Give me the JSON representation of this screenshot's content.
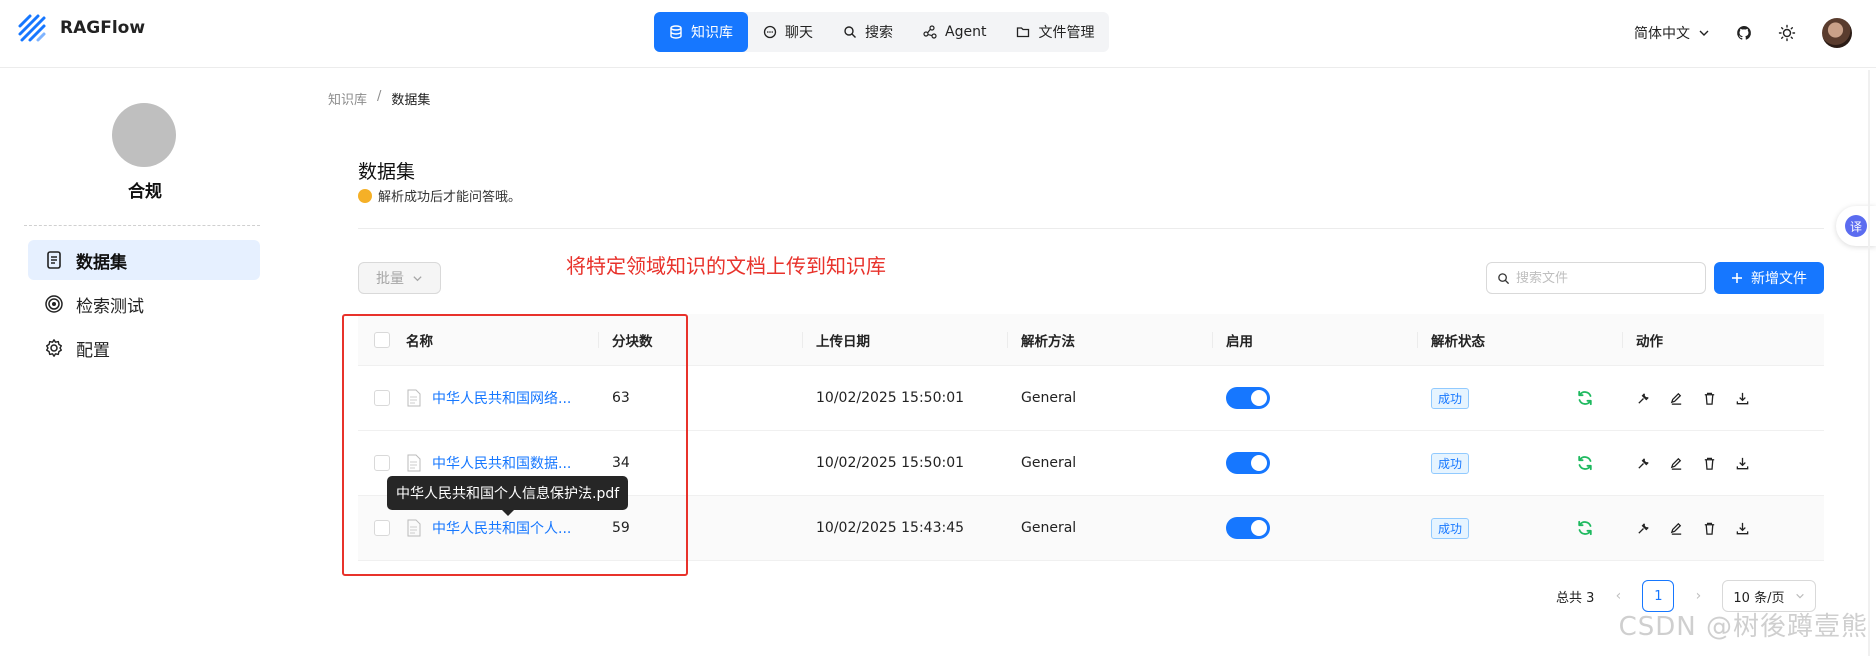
{
  "header": {
    "brand": "RAGFlow",
    "nav": [
      {
        "label": "知识库",
        "icon": "database-icon",
        "active": true
      },
      {
        "label": "聊天",
        "icon": "chat-icon",
        "active": false
      },
      {
        "label": "搜索",
        "icon": "search-icon",
        "active": false
      },
      {
        "label": "Agent",
        "icon": "agent-icon",
        "active": false
      },
      {
        "label": "文件管理",
        "icon": "folder-icon",
        "active": false
      }
    ],
    "language": "简体中文"
  },
  "sidebar": {
    "kb_name": "合规",
    "items": [
      {
        "label": "数据集",
        "icon": "document-icon",
        "active": true
      },
      {
        "label": "检索测试",
        "icon": "target-icon",
        "active": false
      },
      {
        "label": "配置",
        "icon": "gear-icon",
        "active": false
      }
    ]
  },
  "breadcrumb": {
    "root": "知识库",
    "separator": "/",
    "current": "数据集"
  },
  "main": {
    "title": "数据集",
    "description": "解析成功后才能问答哦。",
    "batch_label": "批量",
    "annotation": "将特定领域知识的文档上传到知识库",
    "search_placeholder": "搜索文件",
    "add_label": "新增文件"
  },
  "table": {
    "headers": {
      "name": "名称",
      "chunks": "分块数",
      "date": "上传日期",
      "method": "解析方法",
      "enabled": "启用",
      "status": "解析状态",
      "action": "动作"
    },
    "rows": [
      {
        "name": "中华人民共和国网络...",
        "chunks": "63",
        "date": "10/02/2025 15:50:01",
        "method": "General",
        "enabled": true,
        "status": "成功"
      },
      {
        "name": "中华人民共和国数据...",
        "chunks": "34",
        "date": "10/02/2025 15:50:01",
        "method": "General",
        "enabled": true,
        "status": "成功"
      },
      {
        "name": "中华人民共和国个人...",
        "chunks": "59",
        "date": "10/02/2025 15:43:45",
        "method": "General",
        "enabled": true,
        "status": "成功"
      }
    ],
    "tooltip": "中华人民共和国个人信息保护法.pdf"
  },
  "pagination": {
    "total": "总共 3",
    "current_page": "1",
    "page_size": "10 条/页"
  },
  "float_button": "译",
  "watermark": "CSDN @树後蹲壹熊",
  "colors": {
    "primary": "#1677ff",
    "annotation_red": "#e8322b",
    "success_green": "#1eb95f"
  }
}
